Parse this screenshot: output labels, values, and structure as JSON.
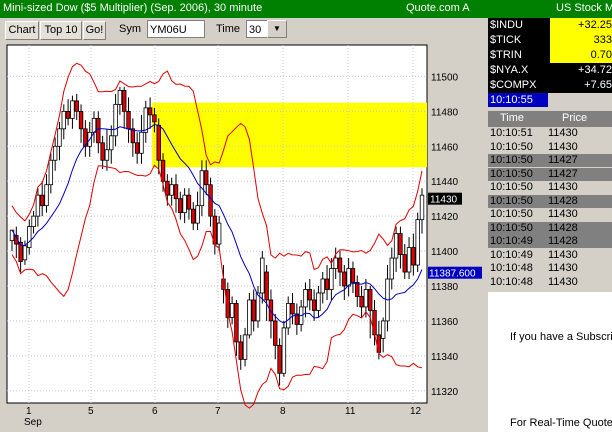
{
  "chart_window": {
    "title": "Mini-sized Dow ($5 Multiplier) (Sep. 2006), 30 minute",
    "quote_label": "Quote.com",
    "quote_tag": "A"
  },
  "toolbar": {
    "chart_label": "Chart",
    "top10_label": "Top 10",
    "go_label": "Go!",
    "sym_label": "Sym",
    "sym_value": "YM06U",
    "time_label": "Time",
    "time_value": "30"
  },
  "chart_data": {
    "type": "candlestick",
    "title": "",
    "ylim": [
      11313,
      11518
    ],
    "y_ticks": [
      "11500",
      "11480",
      "11460",
      "11440",
      "11420",
      "11400",
      "11380",
      "11360",
      "11340",
      "11320"
    ],
    "x_tick_labels": [
      "1",
      "5",
      "6",
      "7",
      "8",
      "11",
      "12"
    ],
    "x_sublabel": "Sep",
    "last_price": "11430",
    "indicator_value": "11387.600",
    "highlight_zone": [
      11448,
      11485
    ],
    "candles": [
      [
        11406,
        11412,
        11400,
        11408
      ],
      [
        11409,
        11404,
        11396,
        11414
      ],
      [
        11405,
        11394,
        11388,
        11408
      ],
      [
        11395,
        11403,
        11392,
        11406
      ],
      [
        11402,
        11414,
        11398,
        11418
      ],
      [
        11414,
        11420,
        11410,
        11423
      ],
      [
        11420,
        11432,
        11414,
        11436
      ],
      [
        11432,
        11426,
        11420,
        11440
      ],
      [
        11426,
        11438,
        11422,
        11444
      ],
      [
        11438,
        11452,
        11433,
        11456
      ],
      [
        11452,
        11460,
        11446,
        11465
      ],
      [
        11460,
        11470,
        11452,
        11474
      ],
      [
        11470,
        11480,
        11464,
        11484
      ],
      [
        11480,
        11476,
        11472,
        11487
      ],
      [
        11476,
        11486,
        11470,
        11489
      ],
      [
        11486,
        11480,
        11475,
        11490
      ],
      [
        11480,
        11470,
        11462,
        11484
      ],
      [
        11470,
        11460,
        11454,
        11475
      ],
      [
        11460,
        11468,
        11454,
        11474
      ],
      [
        11468,
        11476,
        11462,
        11480
      ],
      [
        11476,
        11462,
        11456,
        11480
      ],
      [
        11462,
        11452,
        11447,
        11466
      ],
      [
        11452,
        11458,
        11446,
        11470
      ],
      [
        11458,
        11466,
        11450,
        11472
      ],
      [
        11466,
        11484,
        11460,
        11490
      ],
      [
        11484,
        11492,
        11478,
        11494
      ],
      [
        11492,
        11480,
        11470,
        11494
      ],
      [
        11480,
        11470,
        11462,
        11488
      ],
      [
        11470,
        11462,
        11454,
        11476
      ],
      [
        11462,
        11456,
        11450,
        11468
      ],
      [
        11456,
        11468,
        11450,
        11478
      ],
      [
        11468,
        11482,
        11462,
        11486
      ],
      [
        11482,
        11478,
        11470,
        11488
      ],
      [
        11478,
        11474,
        11468,
        11482
      ],
      [
        11472,
        11452,
        11444,
        11476
      ],
      [
        11452,
        11440,
        11434,
        11456
      ],
      [
        11440,
        11432,
        11426,
        11444
      ],
      [
        11432,
        11438,
        11426,
        11442
      ],
      [
        11438,
        11430,
        11422,
        11444
      ],
      [
        11430,
        11422,
        11418,
        11434
      ],
      [
        11422,
        11432,
        11416,
        11436
      ],
      [
        11432,
        11424,
        11418,
        11436
      ],
      [
        11424,
        11416,
        11412,
        11428
      ],
      [
        11416,
        11426,
        11412,
        11434
      ],
      [
        11426,
        11446,
        11420,
        11452
      ],
      [
        11446,
        11438,
        11432,
        11452
      ],
      [
        11438,
        11420,
        11414,
        11442
      ],
      [
        11420,
        11404,
        11398,
        11424
      ],
      [
        11404,
        11416,
        11400,
        11420
      ],
      [
        11384,
        11378,
        11370,
        11392
      ],
      [
        11378,
        11362,
        11356,
        11382
      ],
      [
        11362,
        11370,
        11358,
        11374
      ],
      [
        11370,
        11348,
        11340,
        11372
      ],
      [
        11348,
        11338,
        11332,
        11352
      ],
      [
        11338,
        11352,
        11334,
        11356
      ],
      [
        11352,
        11372,
        11350,
        11376
      ],
      [
        11372,
        11360,
        11354,
        11378
      ],
      [
        11360,
        11376,
        11356,
        11380
      ],
      [
        11376,
        11396,
        11370,
        11400
      ],
      [
        11388,
        11372,
        11360,
        11392
      ],
      [
        11372,
        11360,
        11350,
        11378
      ],
      [
        11360,
        11346,
        11338,
        11364
      ],
      [
        11346,
        11330,
        11323,
        11350
      ],
      [
        11330,
        11356,
        11328,
        11360
      ],
      [
        11356,
        11370,
        11352,
        11374
      ],
      [
        11370,
        11364,
        11358,
        11376
      ],
      [
        11364,
        11358,
        11352,
        11370
      ],
      [
        11358,
        11368,
        11354,
        11372
      ],
      [
        11368,
        11378,
        11362,
        11382
      ],
      [
        11378,
        11372,
        11366,
        11384
      ],
      [
        11372,
        11366,
        11360,
        11378
      ],
      [
        11366,
        11376,
        11362,
        11380
      ],
      [
        11376,
        11384,
        11370,
        11388
      ],
      [
        11384,
        11378,
        11372,
        11392
      ],
      [
        11378,
        11390,
        11372,
        11396
      ],
      [
        11390,
        11396,
        11384,
        11402
      ],
      [
        11396,
        11388,
        11380,
        11400
      ],
      [
        11388,
        11380,
        11372,
        11392
      ],
      [
        11380,
        11390,
        11374,
        11396
      ],
      [
        11390,
        11382,
        11376,
        11394
      ],
      [
        11382,
        11374,
        11368,
        11386
      ],
      [
        11374,
        11368,
        11362,
        11380
      ],
      [
        11368,
        11378,
        11362,
        11384
      ],
      [
        11378,
        11366,
        11350,
        11380
      ],
      [
        11366,
        11352,
        11346,
        11372
      ],
      [
        11352,
        11342,
        11338,
        11360
      ],
      [
        11350,
        11360,
        11342,
        11362
      ],
      [
        11360,
        11384,
        11354,
        11392
      ],
      [
        11384,
        11396,
        11378,
        11402
      ],
      [
        11396,
        11410,
        11388,
        11414
      ],
      [
        11410,
        11398,
        11390,
        11414
      ],
      [
        11398,
        11388,
        11384,
        11404
      ],
      [
        11388,
        11402,
        11384,
        11408
      ],
      [
        11402,
        11392,
        11386,
        11410
      ],
      [
        11392,
        11418,
        11388,
        11422
      ],
      [
        11418,
        11432,
        11410,
        11436
      ]
    ]
  },
  "quote_window": {
    "title": "US Stock M",
    "rows": [
      {
        "symbol": "$INDU",
        "value": "+32.25",
        "highlight": true
      },
      {
        "symbol": "$TICK",
        "value": "333",
        "highlight": true
      },
      {
        "symbol": "$TRIN",
        "value": "0.70",
        "highlight": true
      },
      {
        "symbol": "$NYA.X",
        "value": "+34.72",
        "highlight": false
      },
      {
        "symbol": "$COMPX",
        "value": "+7.65",
        "highlight": false
      }
    ],
    "clock": "10:10:55"
  },
  "time_sales": {
    "headers": [
      "Time",
      "Price"
    ],
    "rows": [
      {
        "time": "10:10:51",
        "price": "11430",
        "shade": "#d4d0c8"
      },
      {
        "time": "10:10:50",
        "price": "11430",
        "shade": "#d4d0c8"
      },
      {
        "time": "10:10:50",
        "price": "11427",
        "shade": "#808080"
      },
      {
        "time": "10:10:50",
        "price": "11427",
        "shade": "#808080"
      },
      {
        "time": "10:10:50",
        "price": "11430",
        "shade": "#d4d0c8"
      },
      {
        "time": "10:10:50",
        "price": "11428",
        "shade": "#808080"
      },
      {
        "time": "10:10:50",
        "price": "11430",
        "shade": "#d4d0c8"
      },
      {
        "time": "10:10:50",
        "price": "11428",
        "shade": "#808080"
      },
      {
        "time": "10:10:49",
        "price": "11428",
        "shade": "#808080"
      },
      {
        "time": "10:10:49",
        "price": "11430",
        "shade": "#d4d0c8"
      },
      {
        "time": "10:10:48",
        "price": "11430",
        "shade": "#d4d0c8"
      },
      {
        "time": "10:10:48",
        "price": "11430",
        "shade": "#d4d0c8"
      }
    ]
  },
  "subscription": {
    "line1": "If you have a Subscrip",
    "line2": "For Real-Time Quote"
  }
}
